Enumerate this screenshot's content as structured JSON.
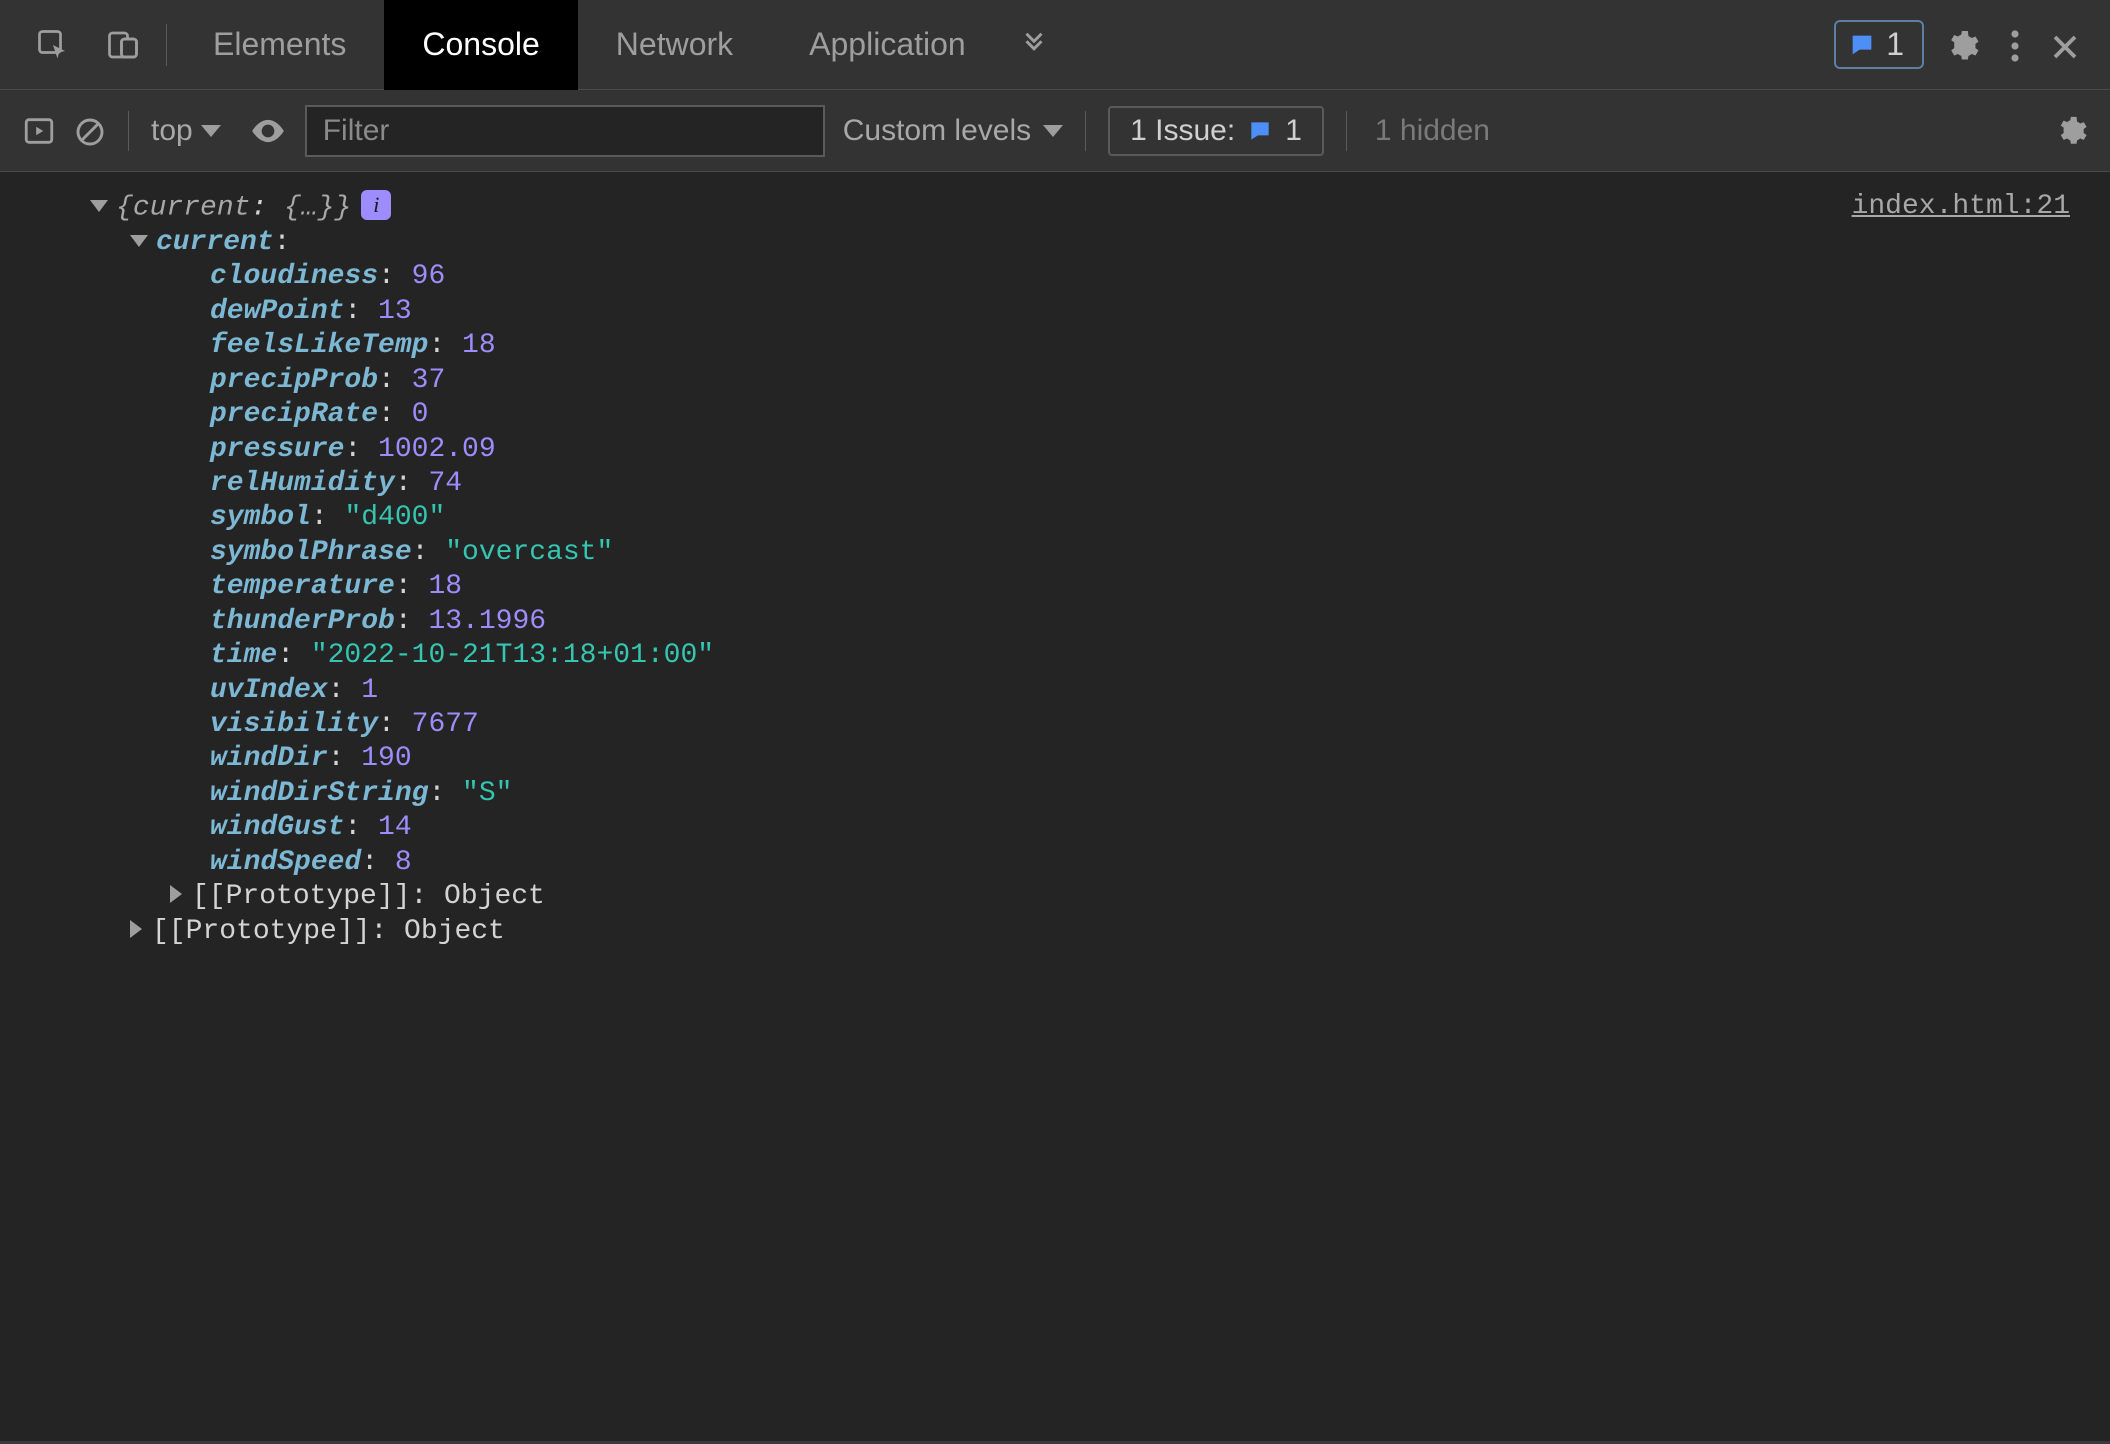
{
  "tabs": {
    "elements": "Elements",
    "console": "Console",
    "network": "Network",
    "application": "Application"
  },
  "topbar": {
    "issue_count": "1"
  },
  "toolbar": {
    "context": "top",
    "filter_placeholder": "Filter",
    "levels_label": "Custom levels",
    "issues_label": "1 Issue:",
    "issues_count": "1",
    "hidden_label": "1 hidden"
  },
  "source_link": "index.html:21",
  "summary": {
    "open_brace": "{",
    "key": "current",
    "preview": "{…}",
    "close_brace": "}"
  },
  "root_key": "current",
  "props": {
    "cloudiness": {
      "k": "cloudiness",
      "v": "96",
      "t": "num"
    },
    "dewPoint": {
      "k": "dewPoint",
      "v": "13",
      "t": "num"
    },
    "feelsLikeTemp": {
      "k": "feelsLikeTemp",
      "v": "18",
      "t": "num"
    },
    "precipProb": {
      "k": "precipProb",
      "v": "37",
      "t": "num"
    },
    "precipRate": {
      "k": "precipRate",
      "v": "0",
      "t": "num"
    },
    "pressure": {
      "k": "pressure",
      "v": "1002.09",
      "t": "num"
    },
    "relHumidity": {
      "k": "relHumidity",
      "v": "74",
      "t": "num"
    },
    "symbol": {
      "k": "symbol",
      "v": "\"d400\"",
      "t": "str"
    },
    "symbolPhrase": {
      "k": "symbolPhrase",
      "v": "\"overcast\"",
      "t": "str"
    },
    "temperature": {
      "k": "temperature",
      "v": "18",
      "t": "num"
    },
    "thunderProb": {
      "k": "thunderProb",
      "v": "13.1996",
      "t": "num"
    },
    "time": {
      "k": "time",
      "v": "\"2022-10-21T13:18+01:00\"",
      "t": "str"
    },
    "uvIndex": {
      "k": "uvIndex",
      "v": "1",
      "t": "num"
    },
    "visibility": {
      "k": "visibility",
      "v": "7677",
      "t": "num"
    },
    "windDir": {
      "k": "windDir",
      "v": "190",
      "t": "num"
    },
    "windDirString": {
      "k": "windDirString",
      "v": "\"S\"",
      "t": "str"
    },
    "windGust": {
      "k": "windGust",
      "v": "14",
      "t": "num"
    },
    "windSpeed": {
      "k": "windSpeed",
      "v": "8",
      "t": "num"
    }
  },
  "proto": {
    "label": "[[Prototype]]",
    "value": "Object"
  },
  "info_badge": "i"
}
